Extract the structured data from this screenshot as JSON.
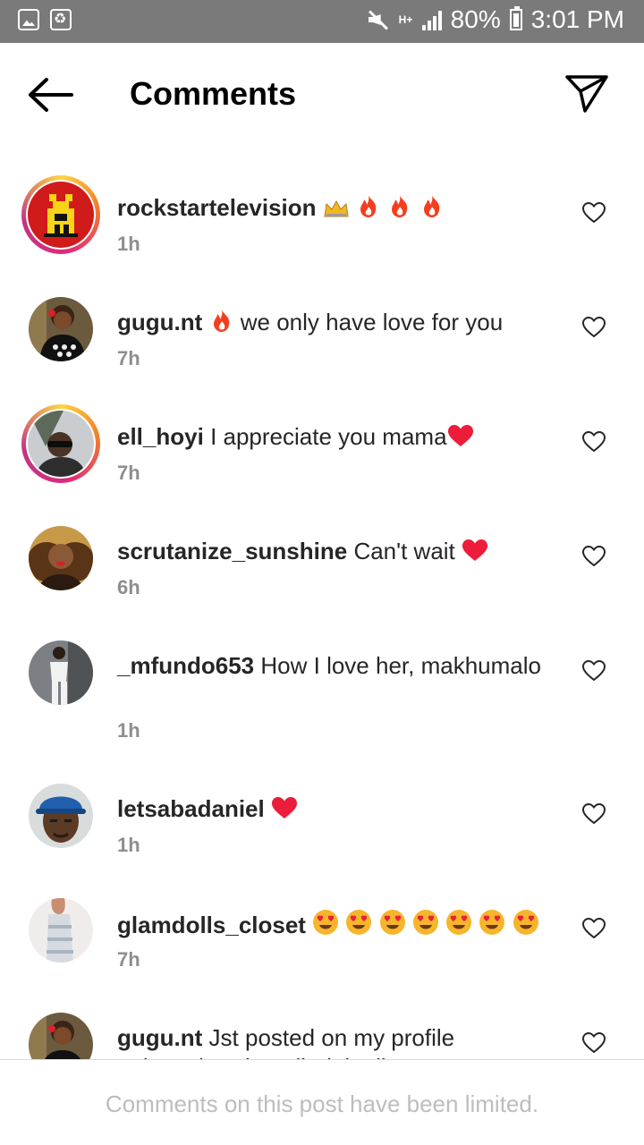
{
  "status_bar": {
    "battery": "80%",
    "time": "3:01 PM",
    "network": "H+",
    "icons": [
      "image-icon",
      "recycle-icon",
      "mute-icon",
      "signal-icon",
      "battery-icon"
    ]
  },
  "header": {
    "title": "Comments",
    "back_icon": "arrow-left-icon",
    "share_icon": "send-icon"
  },
  "comments": [
    {
      "username": "rockstartelevision",
      "text": "",
      "emoji": [
        "crown",
        "fire",
        "fire",
        "fire"
      ],
      "time": "1h",
      "story_ring": true,
      "avatar": "red-logo"
    },
    {
      "username": "gugu.nt",
      "text": "we only have love for you",
      "emoji_before": [
        "fire"
      ],
      "time": "7h",
      "story_ring": false,
      "avatar": "woman-bw-top"
    },
    {
      "username": "ell_hoyi",
      "text": "I appreciate you mama",
      "emoji": [
        "red-heart"
      ],
      "time": "7h",
      "story_ring": true,
      "avatar": "man-sunglasses"
    },
    {
      "username": "scrutanize_sunshine",
      "text": "Can't wait",
      "emoji": [
        "red-heart"
      ],
      "time": "6h",
      "story_ring": false,
      "avatar": "woman-red-lips"
    },
    {
      "username": "_mfundo653",
      "text": "How I love her, makhumalo",
      "time": "1h",
      "story_ring": false,
      "avatar": "person-white-outfit"
    },
    {
      "username": "letsabadaniel",
      "text": "",
      "emoji": [
        "red-heart"
      ],
      "time": "1h",
      "story_ring": false,
      "avatar": "man-blue-cap"
    },
    {
      "username": "glamdolls_closet",
      "text": "",
      "emoji": [
        "heart-eyes",
        "heart-eyes",
        "heart-eyes",
        "heart-eyes",
        "heart-eyes",
        "heart-eyes",
        "heart-eyes"
      ],
      "time": "7h",
      "story_ring": false,
      "avatar": "woman-white-dress"
    },
    {
      "username": "gugu.nt",
      "text": "Jst posted on my profile ngiyamthanda ngibulalenike",
      "time": "",
      "story_ring": false,
      "avatar": "woman-bw-top"
    }
  ],
  "footer": {
    "text": "Comments on this post have been limited."
  },
  "colors": {
    "status_bar": "#7a7a7a",
    "muted_text": "#8e8e8e",
    "heart_red": "#ed1c3a",
    "fire": "#f33f1f"
  }
}
